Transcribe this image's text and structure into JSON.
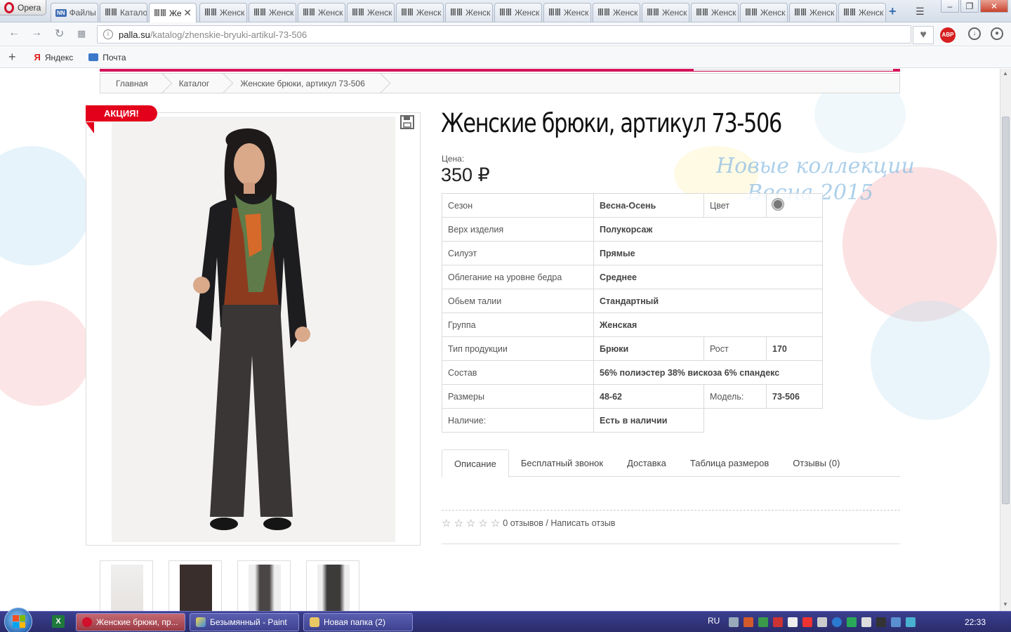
{
  "browser": {
    "app_label": "Opera",
    "tabs": [
      {
        "label": "Файлы",
        "active": false
      },
      {
        "label": "Катало",
        "active": false
      },
      {
        "label": "Же",
        "active": true
      },
      {
        "label": "Женск",
        "active": false
      },
      {
        "label": "Женск",
        "active": false
      },
      {
        "label": "Женск",
        "active": false
      },
      {
        "label": "Женск",
        "active": false
      },
      {
        "label": "Женск",
        "active": false
      },
      {
        "label": "Женск",
        "active": false
      },
      {
        "label": "Женск",
        "active": false
      },
      {
        "label": "Женск",
        "active": false
      },
      {
        "label": "Женск",
        "active": false
      },
      {
        "label": "Женск",
        "active": false
      },
      {
        "label": "Женск",
        "active": false
      },
      {
        "label": "Женск",
        "active": false
      },
      {
        "label": "Женск",
        "active": false
      },
      {
        "label": "Женск",
        "active": false
      },
      {
        "label": "Женск",
        "active": false
      }
    ],
    "url_host": "palla.su",
    "url_path": "/katalog/zhenskie-bryuki-artikul-73-506",
    "adblock_label": "ABP",
    "bookmarks": [
      {
        "label": "Яндекс",
        "icon": "yandex-icon"
      },
      {
        "label": "Почта",
        "icon": "mail-icon"
      }
    ]
  },
  "breadcrumb": [
    "Главная",
    "Каталог",
    "Женские брюки, артикул 73-506"
  ],
  "product": {
    "badge": "АКЦИЯ!",
    "title": "Женские брюки, артикул 73-506",
    "price_label": "Цена:",
    "price": "350 ₽",
    "watermark_line1": "Новые коллекции",
    "watermark_line2": "Весна 2015",
    "specs": {
      "season_key": "Сезон",
      "season_val": "Весна-Осень",
      "color_key": "Цвет",
      "color_val": "#777777",
      "top_key": "Верх изделия",
      "top_val": "Полукорсаж",
      "silhouette_key": "Силуэт",
      "silhouette_val": "Прямые",
      "fit_key": "Облегание на уровне бедра",
      "fit_val": "Среднее",
      "waist_key": "Обьем талии",
      "waist_val": "Стандартный",
      "group_key": "Группа",
      "group_val": "Женская",
      "type_key": "Тип продукции",
      "type_val": "Брюки",
      "height_key": "Рост",
      "height_val": "170",
      "composition_key": "Состав",
      "composition_val": "56% полиэстер 38% вискоза 6% спандекс",
      "sizes_key": "Размеры",
      "sizes_val": "48-62",
      "model_key": "Модель:",
      "model_val": "73-506",
      "availability_key": "Наличие:",
      "availability_val": "Есть в наличии"
    },
    "tabs": [
      "Описание",
      "Бесплатный звонок",
      "Доставка",
      "Таблица размеров",
      "Отзывы (0)"
    ],
    "rating_value": 0,
    "rating_max": 5,
    "reviews_text": "0 отзывов / Написать отзыв"
  },
  "taskbar": {
    "tasks": [
      {
        "label": "Женские брюки, пр...",
        "active": true
      },
      {
        "label": "Безымянный - Paint",
        "active": false
      },
      {
        "label": "Новая папка (2)",
        "active": false
      }
    ],
    "lang": "RU",
    "clock": "22:33"
  }
}
